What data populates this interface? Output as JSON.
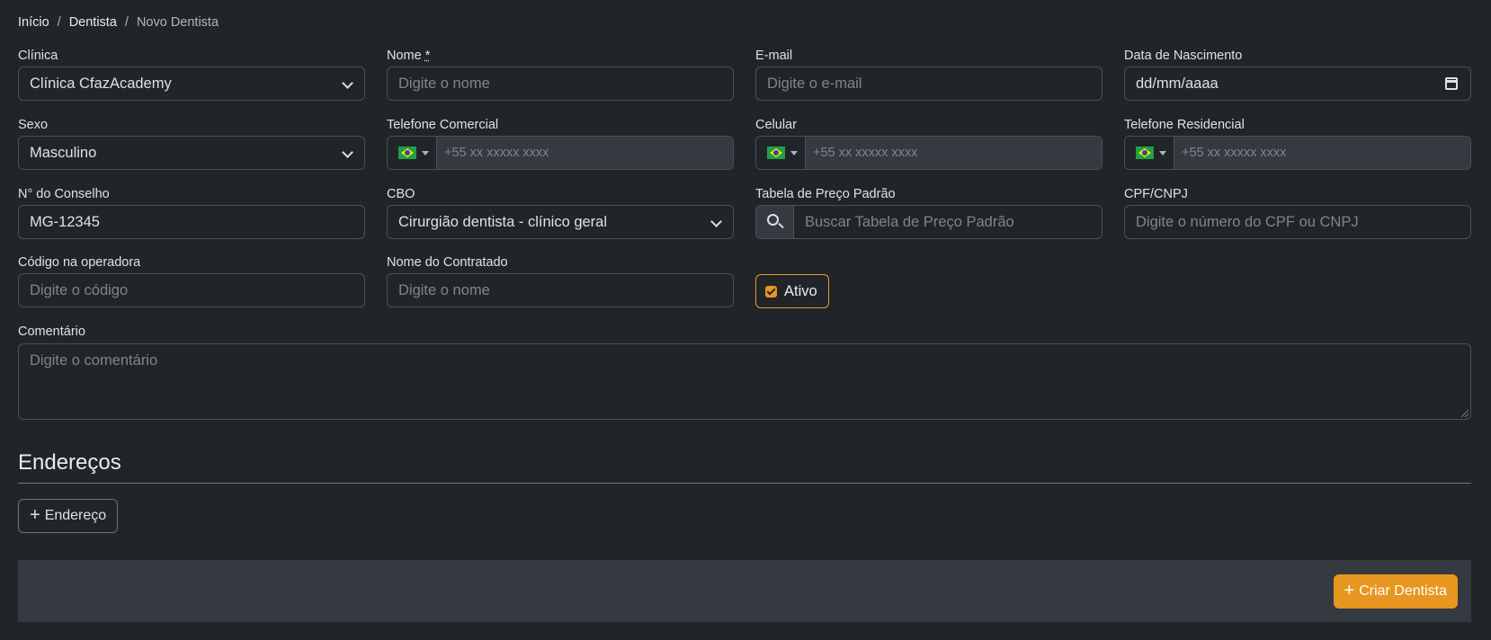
{
  "breadcrumb": {
    "home": "Início",
    "section": "Dentista",
    "current": "Novo Dentista",
    "separator": "/"
  },
  "form": {
    "clinica": {
      "label": "Clínica",
      "value": "Clínica CfazAcademy"
    },
    "nome": {
      "label": "Nome",
      "required_mark": "*",
      "placeholder": "Digite o nome"
    },
    "email": {
      "label": "E-mail",
      "placeholder": "Digite o e-mail"
    },
    "nascimento": {
      "label": "Data de Nascimento",
      "value": "dd/mm/aaaa"
    },
    "sexo": {
      "label": "Sexo",
      "value": "Masculino"
    },
    "tel_comercial": {
      "label": "Telefone Comercial",
      "placeholder": "+55 xx xxxxx xxxx"
    },
    "celular": {
      "label": "Celular",
      "placeholder": "+55 xx xxxxx xxxx"
    },
    "tel_residencial": {
      "label": "Telefone Residencial",
      "placeholder": "+55 xx xxxxx xxxx"
    },
    "conselho": {
      "label": "N° do Conselho",
      "value": "MG-12345"
    },
    "cbo": {
      "label": "CBO",
      "value": "Cirurgião dentista - clínico geral"
    },
    "tabela": {
      "label": "Tabela de Preço Padrão",
      "placeholder": "Buscar Tabela de Preço Padrão"
    },
    "cpf": {
      "label": "CPF/CNPJ",
      "placeholder": "Digite o número do CPF ou CNPJ"
    },
    "codigo": {
      "label": "Código na operadora",
      "placeholder": "Digite o código"
    },
    "contratado": {
      "label": "Nome do Contratado",
      "placeholder": "Digite o nome"
    },
    "ativo": {
      "label": "Ativo",
      "checked": true
    },
    "comentario": {
      "label": "Comentário",
      "placeholder": "Digite o comentário"
    }
  },
  "enderecos": {
    "title": "Endereços",
    "add_label": "Endereço"
  },
  "footer": {
    "submit_label": "Criar Dentista"
  },
  "colors": {
    "accent": "#e7961f",
    "background": "#212529",
    "panel": "#343a40",
    "border": "#495057"
  }
}
